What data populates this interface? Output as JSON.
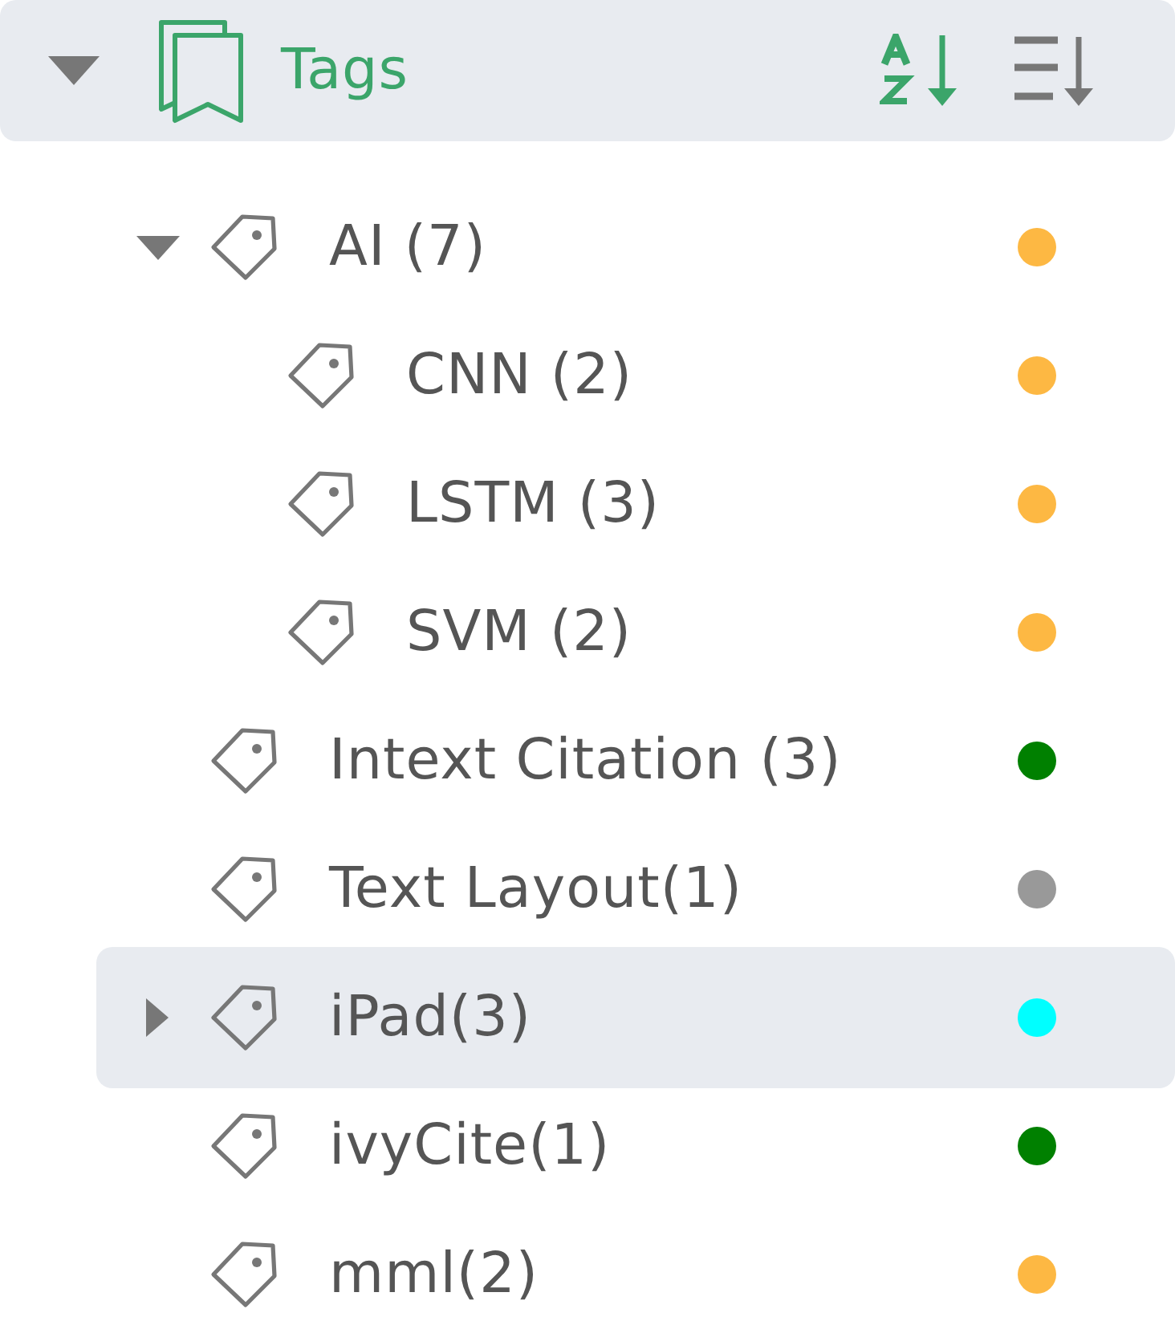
{
  "panel": {
    "title": "Tags",
    "expanded": true,
    "sort_buttons": [
      {
        "kind": "alphabetical",
        "selected": true
      },
      {
        "kind": "list",
        "selected": false
      }
    ]
  },
  "items": [
    {
      "label": "AI (7)",
      "color": "#fdb843",
      "expanded": true,
      "selected": false,
      "children": [
        {
          "label": "CNN (2)",
          "color": "#fdb843",
          "selected": false
        },
        {
          "label": "LSTM (3)",
          "color": "#fdb843",
          "selected": false
        },
        {
          "label": "SVM (2)",
          "color": "#fdb843",
          "selected": false
        }
      ]
    },
    {
      "label": "Intext Citation (3)",
      "color": "#008000",
      "selected": false
    },
    {
      "label": "Text Layout(1)",
      "color": "#999999",
      "selected": false
    },
    {
      "label": "iPad(3)",
      "color": "#00ffff",
      "expanded": false,
      "selected": true
    },
    {
      "label": "ivyCite(1)",
      "color": "#008000",
      "selected": false
    },
    {
      "label": "mml(2)",
      "color": "#fdb843",
      "selected": false
    }
  ]
}
